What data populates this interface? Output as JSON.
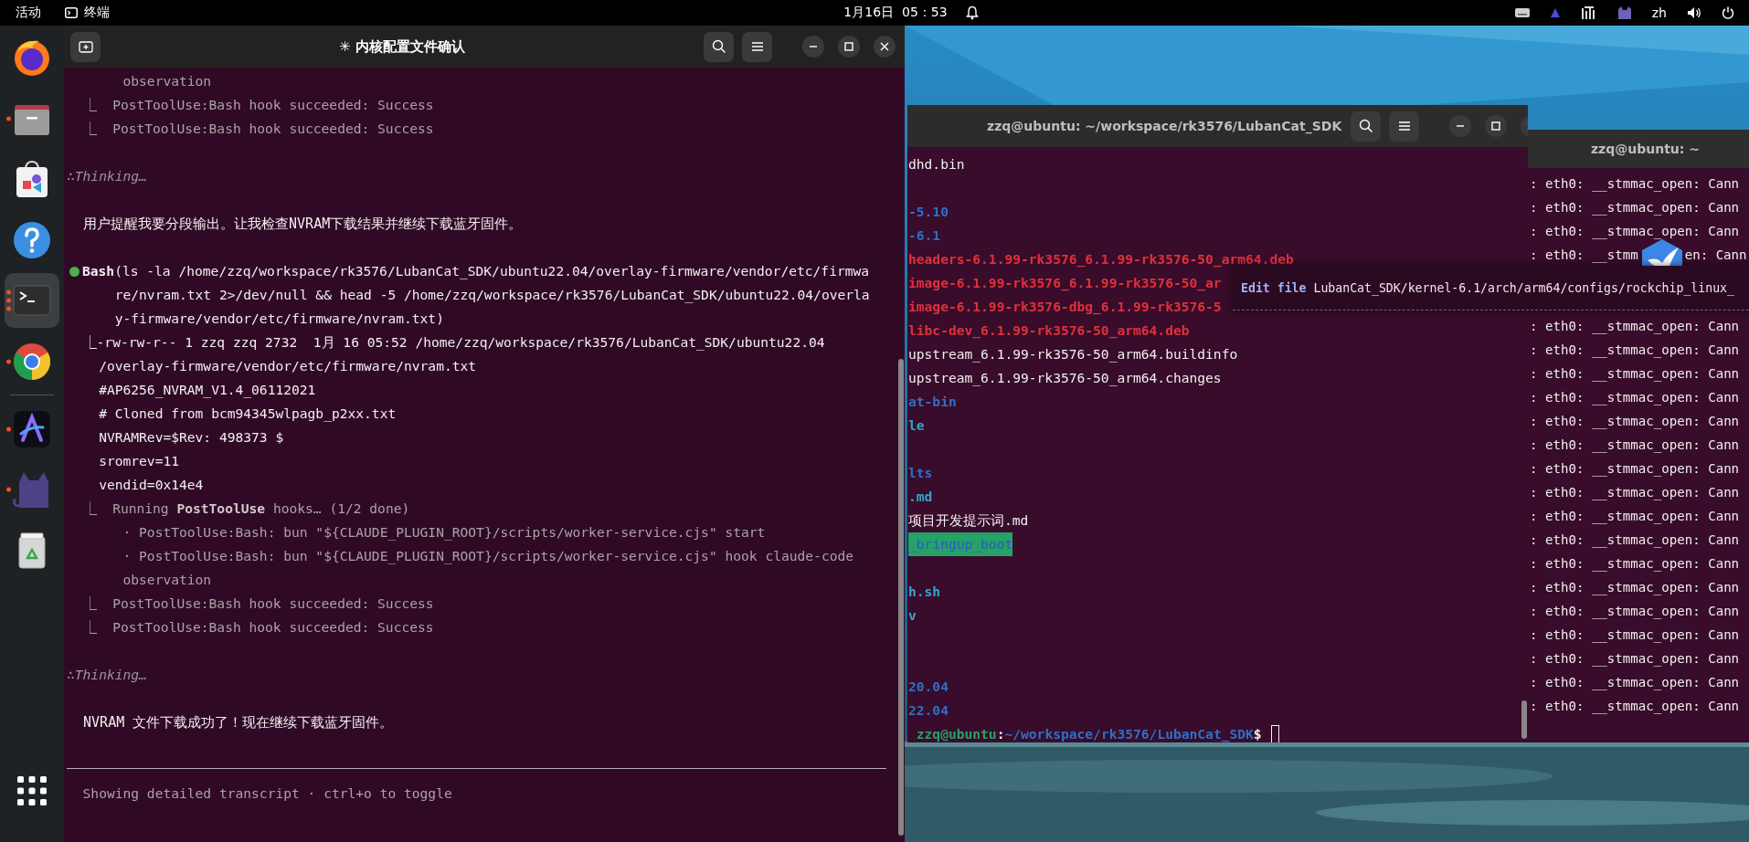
{
  "top_bar": {
    "activities": "活动",
    "app_name": "终端",
    "clock": "1月16日  05：53",
    "input_method": "zh"
  },
  "dock": {
    "favorites": [
      {
        "kind": "firefox",
        "selected": false
      },
      {
        "kind": "files",
        "selected": false,
        "running": true
      },
      {
        "kind": "store",
        "selected": false
      },
      {
        "kind": "help",
        "selected": false
      },
      {
        "kind": "terminal",
        "selected": true,
        "running": true,
        "multi_window": true
      },
      {
        "kind": "chrome",
        "selected": false,
        "running": true
      }
    ],
    "others": [
      {
        "kind": "app",
        "selected": false,
        "running": true
      },
      {
        "kind": "cat",
        "selected": false,
        "running": true
      },
      {
        "kind": "trash",
        "selected": false
      }
    ]
  },
  "windows": [
    {
      "kind": "transcript",
      "title": "✳ 内核配置文件确认",
      "focused": true,
      "new_tab": true,
      "header_buttons": true,
      "lines": [
        {
          "kind": "subcont",
          "text": "observation"
        },
        {
          "kind": "hook",
          "text": "⎿  PostToolUse:Bash hook succeeded: Success"
        },
        {
          "kind": "hook",
          "text": "⎿  PostToolUse:Bash hook succeeded: Success"
        },
        {
          "kind": "blank"
        },
        {
          "kind": "thinking",
          "text": "∴Thinking…"
        },
        {
          "kind": "blank"
        },
        {
          "kind": "prose",
          "text": "用户提醒我要分段输出。让我检查NVRAM下载结果并继续下载蓝牙固件。"
        },
        {
          "kind": "blank"
        },
        {
          "kind": "tool",
          "succeeded": true,
          "text": "**Bash**(ls -la /home/zzq/workspace/rk3576/LubanCat_SDK/ubuntu22.04/overlay-firmware/vendor/etc/firmwa"
        },
        {
          "kind": "cont",
          "text": "re/nvram.txt 2>/dev/null && head -5 /home/zzq/workspace/rk3576/LubanCat_SDK/ubuntu22.04/overla"
        },
        {
          "kind": "cont",
          "text": "y-firmware/vendor/etc/firmware/nvram.txt)"
        },
        {
          "kind": "result",
          "text": "⎿-rw-rw-r-- 1 zzq zzq 2732  1月 16 05:52 /home/zzq/workspace/rk3576/LubanCat_SDK/ubuntu22.04"
        },
        {
          "kind": "output",
          "text": "/overlay-firmware/vendor/etc/firmware/nvram.txt"
        },
        {
          "kind": "output",
          "text": "#AP6256_NVRAM_V1.4_06112021"
        },
        {
          "kind": "output",
          "text": "# Cloned from bcm94345wlpagb_p2xx.txt"
        },
        {
          "kind": "output",
          "text": "NVRAMRev=$Rev: 498373 $"
        },
        {
          "kind": "output",
          "text": "sromrev=11"
        },
        {
          "kind": "output",
          "text": "vendid=0x14e4"
        },
        {
          "kind": "hook",
          "text": "⎿  Running **PostToolUse** hooks… (1/2 done)"
        },
        {
          "kind": "sub",
          "text": "· PostToolUse:Bash: bun \"${CLAUDE_PLUGIN_ROOT}/scripts/worker-service.cjs\" start"
        },
        {
          "kind": "sub",
          "text": "· PostToolUse:Bash: bun \"${CLAUDE_PLUGIN_ROOT}/scripts/worker-service.cjs\" hook claude-code"
        },
        {
          "kind": "subcont",
          "text": "observation"
        },
        {
          "kind": "hook",
          "text": "⎿  PostToolUse:Bash hook succeeded: Success"
        },
        {
          "kind": "hook",
          "text": "⎿  PostToolUse:Bash hook succeeded: Success"
        },
        {
          "kind": "blank"
        },
        {
          "kind": "thinking",
          "text": "∴Thinking…"
        },
        {
          "kind": "blank"
        },
        {
          "kind": "prose",
          "text": "NVRAM 文件下载成功了！现在继续下载蓝牙固件。"
        }
      ],
      "footer": "Showing detailed transcript · ctrl+o to toggle"
    },
    {
      "kind": "listing",
      "title": "zzq@ubuntu: ~/workspace/rk3576/LubanCat_SDK",
      "focused": false,
      "header_buttons": true,
      "lines": [
        {
          "kind": "file",
          "text": "dhd.bin"
        },
        {
          "kind": "blank"
        },
        {
          "kind": "dir",
          "text": "-5.10"
        },
        {
          "kind": "dir",
          "text": "-6.1"
        },
        {
          "kind": "archive",
          "text": "headers-6.1.99-rk3576_6.1.99-rk3576-50_arm64.deb"
        },
        {
          "kind": "archive",
          "text": "image-6.1.99-rk3576_6.1.99-rk3576-50_ar"
        },
        {
          "kind": "archive",
          "text": "image-6.1.99-rk3576-dbg_6.1.99-rk3576-5"
        },
        {
          "kind": "archive",
          "text": "libc-dev_6.1.99-rk3576-50_arm64.deb"
        },
        {
          "kind": "file",
          "text": "upstream_6.1.99-rk3576-50_arm64.buildinfo"
        },
        {
          "kind": "file",
          "text": "upstream_6.1.99-rk3576-50_arm64.changes"
        },
        {
          "kind": "dir",
          "text": "at-bin"
        },
        {
          "kind": "link",
          "text": "le"
        },
        {
          "kind": "blank"
        },
        {
          "kind": "dir",
          "text": "lts"
        },
        {
          "kind": "link",
          "text": ".md"
        },
        {
          "kind": "file",
          "text": "项目开发提示词.md"
        },
        {
          "kind": "sticky",
          "text": "_bringup_boot"
        },
        {
          "kind": "blank"
        },
        {
          "kind": "link",
          "text": "h.sh"
        },
        {
          "kind": "link",
          "text": "v"
        },
        {
          "kind": "blank"
        },
        {
          "kind": "blank"
        },
        {
          "kind": "dir",
          "text": "20.04"
        },
        {
          "kind": "dir",
          "text": "22.04"
        },
        {
          "kind": "prompt",
          "user": "zzq@ubuntu",
          "sep": ":",
          "path": "~/workspace/rk3576/LubanCat_SDK",
          "symbol": "$",
          "cursor": true
        }
      ]
    },
    {
      "kind": "log",
      "title": "zzq@ubuntu: ~",
      "focused": false,
      "lines": [
        {
          "kind": "log",
          "text": ": eth0: __stmmac_open: Cann"
        },
        {
          "kind": "log",
          "text": ": eth0: __stmmac_open: Cann"
        },
        {
          "kind": "log",
          "text": ": eth0: __stmmac_open: Cann"
        },
        {
          "kind": "split",
          "text": ": eth0: __stmm",
          "tail": "en: Cann"
        },
        {
          "kind": "covered"
        },
        {
          "kind": "covered"
        },
        {
          "kind": "log",
          "text": ": eth0: __stmmac_open: Cann"
        },
        {
          "kind": "log",
          "text": ": eth0: __stmmac_open: Cann"
        },
        {
          "kind": "log",
          "text": ": eth0: __stmmac_open: Cann"
        },
        {
          "kind": "log",
          "text": ": eth0: __stmmac_open: Cann"
        },
        {
          "kind": "log",
          "text": ": eth0: __stmmac_open: Cann"
        },
        {
          "kind": "log",
          "text": ": eth0: __stmmac_open: Cann"
        },
        {
          "kind": "log",
          "text": ": eth0: __stmmac_open: Cann"
        },
        {
          "kind": "log",
          "text": ": eth0: __stmmac_open: Cann"
        },
        {
          "kind": "log",
          "text": ": eth0: __stmmac_open: Cann"
        },
        {
          "kind": "log",
          "text": ": eth0: __stmmac_open: Cann"
        },
        {
          "kind": "log",
          "text": ": eth0: __stmmac_open: Cann"
        },
        {
          "kind": "log",
          "text": ": eth0: __stmmac_open: Cann"
        },
        {
          "kind": "log",
          "text": ": eth0: __stmmac_open: Cann"
        },
        {
          "kind": "log",
          "text": ": eth0: __stmmac_open: Cann"
        },
        {
          "kind": "log",
          "text": ": eth0: __stmmac_open: Cann"
        },
        {
          "kind": "log",
          "text": ": eth0: __stmmac_open: Cann"
        },
        {
          "kind": "log",
          "text": ": eth0: __stmmac_open: Cann"
        }
      ]
    }
  ],
  "tooltip": {
    "action": "Edit file",
    "path": "LubanCat_SDK/kernel-6.1/arch/arm64/configs/rockchip_linux_"
  }
}
